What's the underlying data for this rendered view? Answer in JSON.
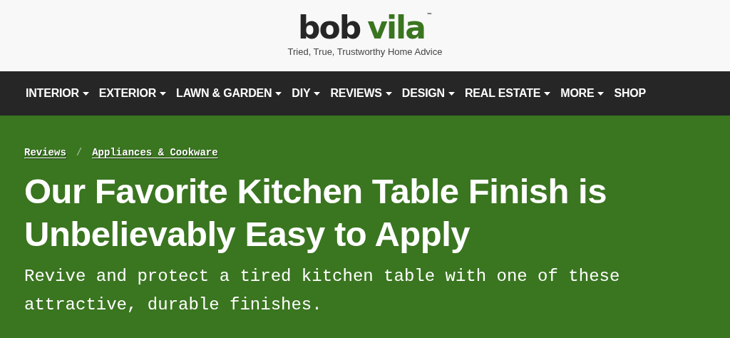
{
  "logo": {
    "primary": "bob",
    "accent": "vila",
    "trademark": "™"
  },
  "tagline": "Tried, True, Trustworthy Home Advice",
  "nav": [
    {
      "label": "INTERIOR",
      "has_dropdown": true
    },
    {
      "label": "EXTERIOR",
      "has_dropdown": true
    },
    {
      "label": "LAWN & GARDEN",
      "has_dropdown": true
    },
    {
      "label": "DIY",
      "has_dropdown": true
    },
    {
      "label": "REVIEWS",
      "has_dropdown": true
    },
    {
      "label": "DESIGN",
      "has_dropdown": true
    },
    {
      "label": "REAL ESTATE",
      "has_dropdown": true
    },
    {
      "label": "MORE",
      "has_dropdown": true
    },
    {
      "label": "SHOP",
      "has_dropdown": false
    }
  ],
  "breadcrumbs": [
    "Reviews",
    "Appliances & Cookware"
  ],
  "breadcrumb_separator": "/",
  "headline": "Our Favorite Kitchen Table Finish is Unbelievably Easy to Apply",
  "subheadline": "Revive and protect a tired kitchen table with one of these attractive, durable finishes."
}
